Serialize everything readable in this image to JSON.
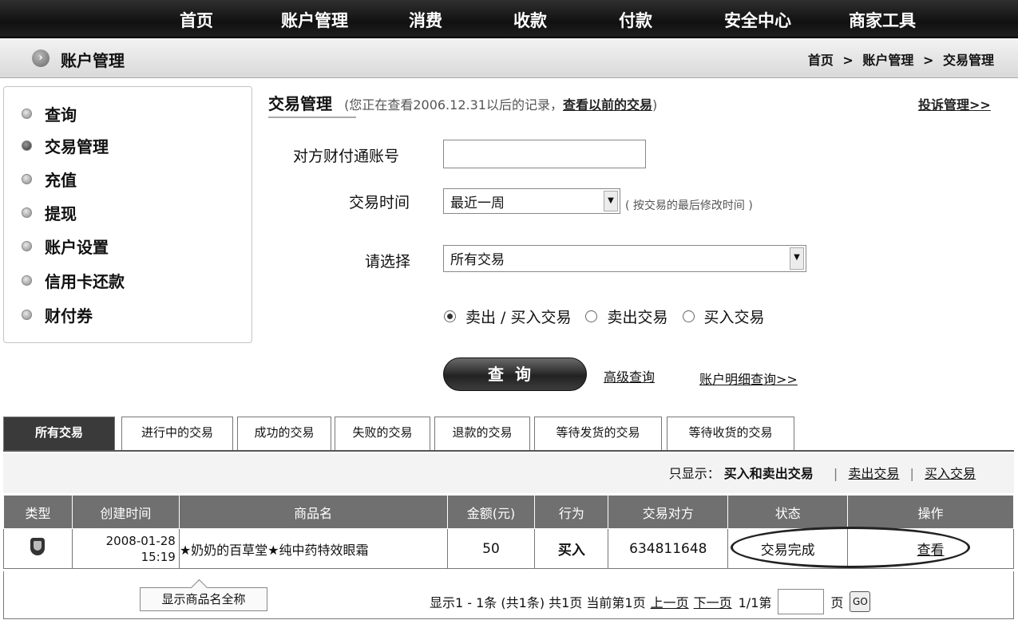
{
  "topnav": [
    "首页",
    "账户管理",
    "消费",
    "收款",
    "付款",
    "安全中心",
    "商家工具"
  ],
  "titlebar": {
    "title": "账户管理",
    "crumbs": [
      "首页",
      ">",
      "账户管理",
      ">",
      "交易管理"
    ]
  },
  "sidebar": [
    "查询",
    "交易管理",
    "充值",
    "提现",
    "账户设置",
    "信用卡还款",
    "财付券"
  ],
  "panel": {
    "title": "交易管理",
    "note_prefix": "(您正在查看2006.12.31以后的记录，",
    "note_link": "查看以前的交易",
    "note_suffix": ")",
    "complaint": "投诉管理>>"
  },
  "form": {
    "account_label": "对方财付通账号",
    "account_value": "",
    "time_label": "交易时间",
    "time_value": "最近一周",
    "time_hint": "( 按交易的最后修改时间 )",
    "select_label": "请选择",
    "select_value": "所有交易",
    "radios": [
      "卖出 / 买入交易",
      "卖出交易",
      "买入交易"
    ],
    "query_button": "查询",
    "advanced_link": "高级查询",
    "detail_link": "账户明细查询>>"
  },
  "tabs": [
    "所有交易",
    "进行中的交易",
    "成功的交易",
    "失败的交易",
    "退款的交易",
    "等待发货的交易",
    "等待收货的交易"
  ],
  "filter": {
    "label": "只显示：",
    "current": "买入和卖出交易",
    "opt1": "卖出交易",
    "opt2": "买入交易",
    "sep": "|"
  },
  "table": {
    "headers": [
      "类型",
      "创建时间",
      "商品名",
      "金额(元)",
      "行为",
      "交易对方",
      "状态",
      "操作"
    ],
    "row": {
      "date": "2008-01-28",
      "time": "15:19",
      "name": "★奶奶的百草堂★纯中药特效眼霜",
      "amount": "50",
      "action": "买入",
      "party": "634811648",
      "status": "交易完成",
      "op": "查看"
    }
  },
  "tooltip": "显示商品名全称",
  "pager": {
    "summary": "显示1 - 1条 (共1条) 共1页 当前第1页",
    "prev": "上一页",
    "next": "下一页",
    "pos": "1/1第",
    "page_suffix": "页",
    "go": "GO"
  }
}
